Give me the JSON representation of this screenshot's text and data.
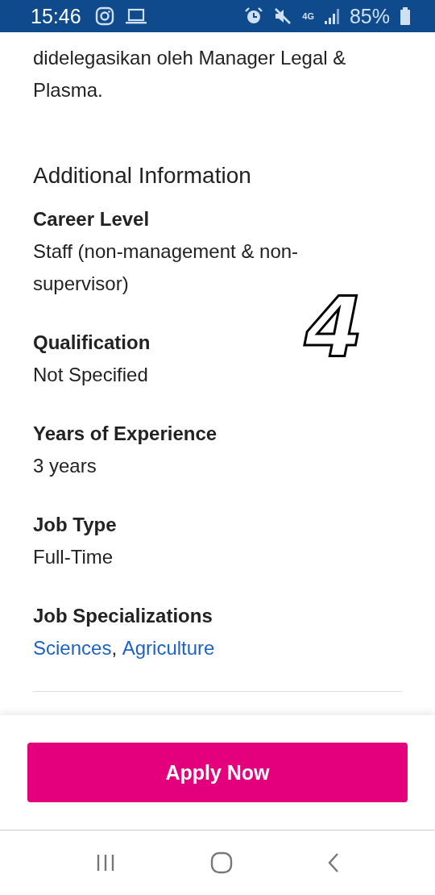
{
  "status_bar": {
    "time": "15:46",
    "network": "4G",
    "battery": "85%"
  },
  "description_tail": "didelegasikan oleh Manager Legal & Plasma.",
  "section_title": "Additional Information",
  "fields": [
    {
      "label": "Career Level",
      "value": "Staff (non-management & non-supervisor)"
    },
    {
      "label": "Qualification",
      "value": "Not Specified"
    },
    {
      "label": "Years of Experience",
      "value": "3 years"
    },
    {
      "label": "Job Type",
      "value": "Full-Time"
    }
  ],
  "specializations": {
    "label": "Job Specializations",
    "links": [
      "Sciences",
      "Agriculture"
    ],
    "separator": ","
  },
  "annotation": "4",
  "apply_button": "Apply Now"
}
